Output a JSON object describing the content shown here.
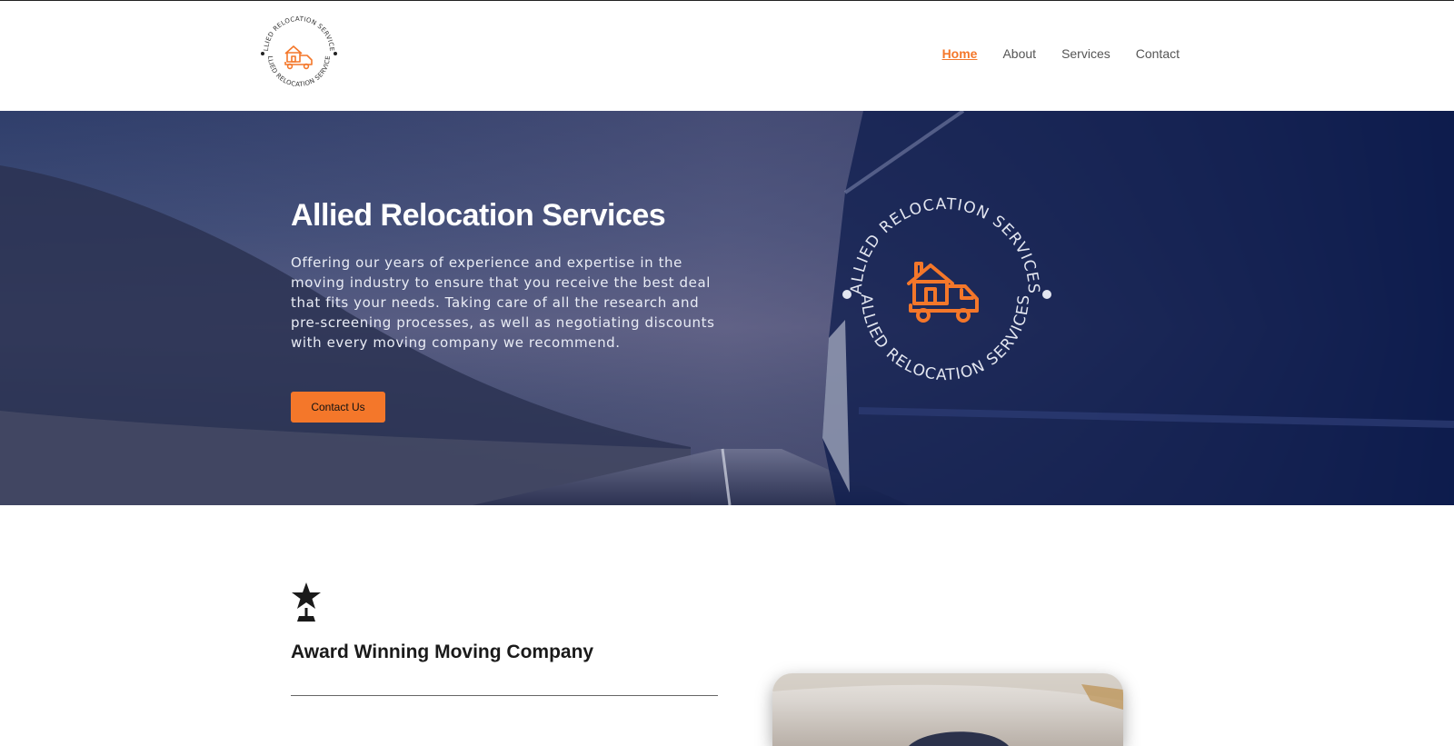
{
  "brand": {
    "name": "Allied Relocation Services",
    "logo_text": "ALLIED RELOCATION SERVICES",
    "accent_color": "#f4772a"
  },
  "nav": {
    "items": [
      {
        "label": "Home",
        "active": true
      },
      {
        "label": "About",
        "active": false
      },
      {
        "label": "Services",
        "active": false
      },
      {
        "label": "Contact",
        "active": false
      }
    ]
  },
  "hero": {
    "title": "Allied Relocation Services",
    "description": "Offering our years of experience and expertise in the moving industry to ensure that you receive the best deal that fits your needs. Taking care of all the research and pre-screening processes, as well as negotiating discounts with every moving company we recommend.",
    "button_label": "Contact Us",
    "badge_text": "ALLIED RELOCATION SERVICES"
  },
  "feature": {
    "icon": "award-trophy-icon",
    "title": "Award Winning Moving Company"
  }
}
